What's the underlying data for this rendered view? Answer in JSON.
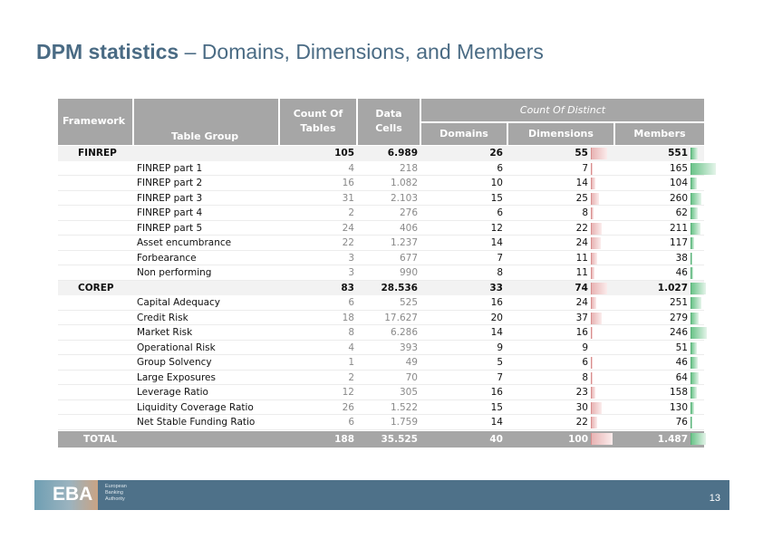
{
  "slide": {
    "title_bold": "DPM statistics",
    "title_rest": " – Domains, Dimensions, and Members",
    "page_number": "13"
  },
  "footer": {
    "logo_text": "EBA",
    "logo_subtitle_lines": [
      "European",
      "Banking",
      "Authority"
    ]
  },
  "table": {
    "headers": {
      "framework": "Framework",
      "table_group": "Table Group",
      "count_of_tables": [
        "Count Of",
        "Tables"
      ],
      "data_cells": [
        "Data",
        "Cells"
      ],
      "count_of_distinct": "Count Of Distinct",
      "domains": "Domains",
      "dimensions": "Dimensions",
      "members": "Members"
    },
    "colors": {
      "header_bg": "#a6a6a6",
      "group_bg": "#f2f2f2",
      "dim_bar": "#e8b4b4",
      "mem_bar": "#6cc48a"
    },
    "rows": [
      {
        "type": "grp",
        "framework": "FINREP",
        "group": "",
        "tables": "105",
        "cells": "6.989",
        "domains": "26",
        "dimensions": "55",
        "members": "551",
        "dim_bar": 0.75,
        "mem_bar": 0.3
      },
      {
        "type": "sub",
        "framework": "",
        "group": "FINREP part 1",
        "tables": "4",
        "cells": "218",
        "domains": "6",
        "dimensions": "7",
        "members": "165",
        "dim_bar": 0.08,
        "mem_bar": 1.0
      },
      {
        "type": "sub",
        "framework": "",
        "group": "FINREP part 2",
        "tables": "16",
        "cells": "1.082",
        "domains": "10",
        "dimensions": "14",
        "members": "104",
        "dim_bar": 0.2,
        "mem_bar": 0.25
      },
      {
        "type": "sub",
        "framework": "",
        "group": "FINREP part 3",
        "tables": "31",
        "cells": "2.103",
        "domains": "15",
        "dimensions": "25",
        "members": "260",
        "dim_bar": 0.38,
        "mem_bar": 0.42
      },
      {
        "type": "sub",
        "framework": "",
        "group": "FINREP part 4",
        "tables": "2",
        "cells": "276",
        "domains": "6",
        "dimensions": "8",
        "members": "62",
        "dim_bar": 0.12,
        "mem_bar": 0.3
      },
      {
        "type": "sub",
        "framework": "",
        "group": "FINREP part 5",
        "tables": "24",
        "cells": "406",
        "domains": "12",
        "dimensions": "22",
        "members": "211",
        "dim_bar": 0.5,
        "mem_bar": 0.38
      },
      {
        "type": "sub",
        "framework": "",
        "group": "Asset encumbrance",
        "tables": "22",
        "cells": "1.237",
        "domains": "14",
        "dimensions": "24",
        "members": "117",
        "dim_bar": 0.45,
        "mem_bar": 0.15
      },
      {
        "type": "sub",
        "framework": "",
        "group": "Forbearance",
        "tables": "3",
        "cells": "677",
        "domains": "7",
        "dimensions": "11",
        "members": "38",
        "dim_bar": 0.3,
        "mem_bar": 0.08
      },
      {
        "type": "sub",
        "framework": "",
        "group": "Non performing",
        "tables": "3",
        "cells": "990",
        "domains": "8",
        "dimensions": "11",
        "members": "46",
        "dim_bar": 0.18,
        "mem_bar": 0.1
      },
      {
        "type": "grp",
        "framework": "COREP",
        "group": "",
        "tables": "83",
        "cells": "28.536",
        "domains": "33",
        "dimensions": "74",
        "members": "1.027",
        "dim_bar": 0.75,
        "mem_bar": 0.6
      },
      {
        "type": "sub",
        "framework": "",
        "group": "Capital Adequacy",
        "tables": "6",
        "cells": "525",
        "domains": "16",
        "dimensions": "24",
        "members": "251",
        "dim_bar": 0.25,
        "mem_bar": 0.42
      },
      {
        "type": "sub",
        "framework": "",
        "group": "Credit Risk",
        "tables": "18",
        "cells": "17.627",
        "domains": "20",
        "dimensions": "37",
        "members": "279",
        "dim_bar": 0.5,
        "mem_bar": 0.32
      },
      {
        "type": "sub",
        "framework": "",
        "group": "Market Risk",
        "tables": "8",
        "cells": "6.286",
        "domains": "14",
        "dimensions": "16",
        "members": "246",
        "dim_bar": 0.08,
        "mem_bar": 0.65
      },
      {
        "type": "sub",
        "framework": "",
        "group": "Operational Risk",
        "tables": "4",
        "cells": "393",
        "domains": "9",
        "dimensions": "9",
        "members": "51",
        "dim_bar": 0.0,
        "mem_bar": 0.25
      },
      {
        "type": "sub",
        "framework": "",
        "group": "Group Solvency",
        "tables": "1",
        "cells": "49",
        "domains": "5",
        "dimensions": "6",
        "members": "46",
        "dim_bar": 0.08,
        "mem_bar": 0.3
      },
      {
        "type": "sub",
        "framework": "",
        "group": "Large Exposures",
        "tables": "2",
        "cells": "70",
        "domains": "7",
        "dimensions": "8",
        "members": "64",
        "dim_bar": 0.08,
        "mem_bar": 0.32
      },
      {
        "type": "sub",
        "framework": "",
        "group": "Leverage Ratio",
        "tables": "12",
        "cells": "305",
        "domains": "16",
        "dimensions": "23",
        "members": "158",
        "dim_bar": 0.2,
        "mem_bar": 0.25
      },
      {
        "type": "sub",
        "framework": "",
        "group": "Liquidity Coverage Ratio",
        "tables": "26",
        "cells": "1.522",
        "domains": "15",
        "dimensions": "30",
        "members": "130",
        "dim_bar": 0.5,
        "mem_bar": 0.15
      },
      {
        "type": "sub",
        "framework": "",
        "group": "Net Stable Funding Ratio",
        "tables": "6",
        "cells": "1.759",
        "domains": "14",
        "dimensions": "22",
        "members": "76",
        "dim_bar": 0.3,
        "mem_bar": 0.06
      },
      {
        "type": "total",
        "framework": "TOTAL",
        "group": "",
        "tables": "188",
        "cells": "35.525",
        "domains": "40",
        "dimensions": "100",
        "members": "1.487",
        "dim_bar": 1.0,
        "mem_bar": 0.6
      }
    ]
  }
}
